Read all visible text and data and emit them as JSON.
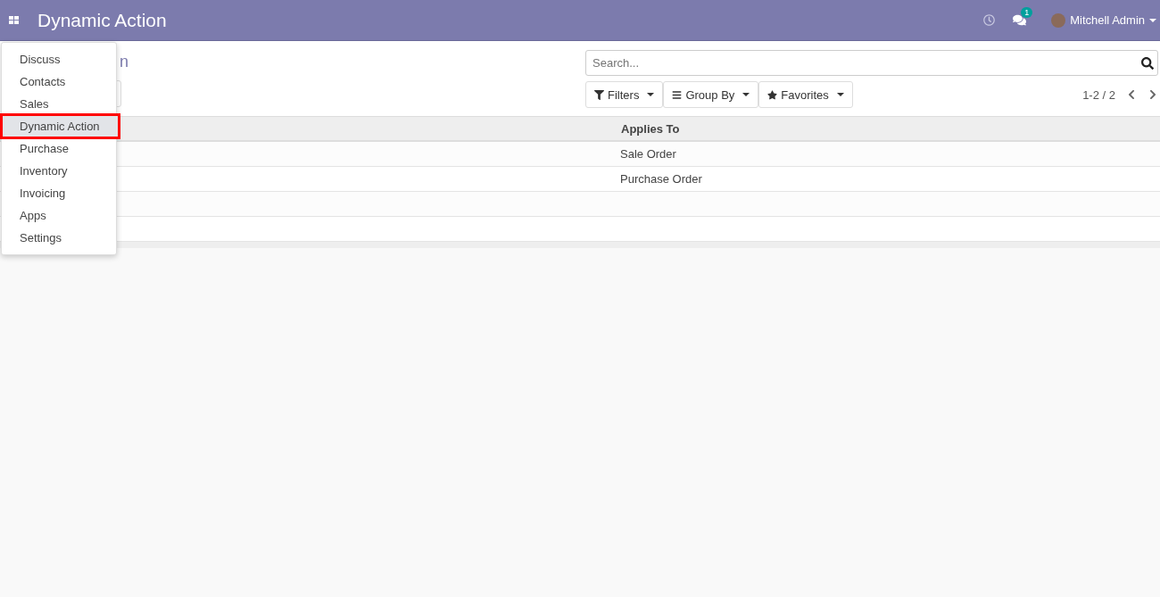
{
  "navbar": {
    "title": "Dynamic Action",
    "chat_badge": "1",
    "user": "Mitchell Admin"
  },
  "app_menu": [
    {
      "label": "Discuss",
      "selected": false
    },
    {
      "label": "Contacts",
      "selected": false
    },
    {
      "label": "Sales",
      "selected": false
    },
    {
      "label": "Dynamic Action",
      "selected": true
    },
    {
      "label": "Purchase",
      "selected": false
    },
    {
      "label": "Inventory",
      "selected": false
    },
    {
      "label": "Invoicing",
      "selected": false
    },
    {
      "label": "Apps",
      "selected": false
    },
    {
      "label": "Settings",
      "selected": false
    }
  ],
  "breadcrumb": "n",
  "search": {
    "placeholder": "Search..."
  },
  "filters": [
    {
      "kind": "filter",
      "label": "Filters"
    },
    {
      "kind": "group",
      "label": "Group By"
    },
    {
      "kind": "favorite",
      "label": "Favorites"
    }
  ],
  "pager": "1-2 / 2",
  "table": {
    "columns": [
      "Applies To"
    ],
    "rows": [
      [
        "Sale Order"
      ],
      [
        "Purchase Order"
      ],
      [
        ""
      ],
      [
        ""
      ]
    ]
  }
}
